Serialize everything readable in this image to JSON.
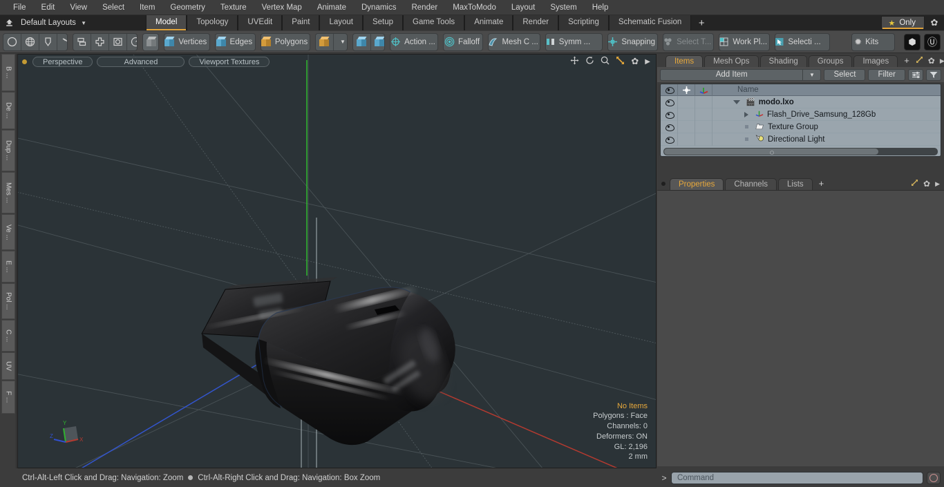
{
  "menubar": {
    "items": [
      "File",
      "Edit",
      "View",
      "Select",
      "Item",
      "Geometry",
      "Texture",
      "Vertex Map",
      "Animate",
      "Dynamics",
      "Render",
      "MaxToModo",
      "Layout",
      "System",
      "Help"
    ]
  },
  "layoutbar": {
    "home_icon": "home-icon",
    "layout_name": "Default Layouts",
    "tabs": [
      {
        "label": "Model",
        "active": true
      },
      {
        "label": "Topology",
        "active": false
      },
      {
        "label": "UVEdit",
        "active": false
      },
      {
        "label": "Paint",
        "active": false
      },
      {
        "label": "Layout",
        "active": false
      },
      {
        "label": "Setup",
        "active": false
      },
      {
        "label": "Game Tools",
        "active": false
      },
      {
        "label": "Animate",
        "active": false
      },
      {
        "label": "Render",
        "active": false
      },
      {
        "label": "Scripting",
        "active": false
      },
      {
        "label": "Schematic Fusion",
        "active": false
      }
    ],
    "add_tab_label": "+",
    "only_label": "Only",
    "only_icon": "star-icon",
    "gear_icon": "gear-icon"
  },
  "toolbar": {
    "groups": [
      {
        "items": [
          {
            "icon": "circle-icon",
            "label": ""
          },
          {
            "icon": "globe-icon",
            "label": ""
          },
          {
            "icon": "pen-icon",
            "label": ""
          },
          {
            "icon": "curve-icon",
            "label": ""
          }
        ]
      },
      {
        "items": [
          {
            "icon": "align-icon",
            "label": ""
          },
          {
            "icon": "center-icon",
            "label": ""
          },
          {
            "icon": "bound-icon",
            "label": ""
          },
          {
            "icon": "radial-icon",
            "label": ""
          }
        ]
      },
      {
        "items": [
          {
            "icon": "cube-grey-icon",
            "label": ""
          }
        ]
      },
      {
        "items": [
          {
            "icon": "cube-blue-icon",
            "label": "Vertices"
          }
        ]
      },
      {
        "items": [
          {
            "icon": "cube-blue-icon",
            "label": "Edges"
          }
        ]
      },
      {
        "items": [
          {
            "icon": "cube-orange-icon",
            "label": "Polygons"
          }
        ]
      },
      {
        "items": [
          {
            "icon": "cube-orange-icon",
            "label": ""
          },
          {
            "icon": "chevron-down-icon",
            "label": ""
          }
        ]
      },
      {
        "items": [
          {
            "icon": "cube-item-a-icon",
            "label": ""
          },
          {
            "icon": "cube-item-b-icon",
            "label": ""
          }
        ]
      },
      {
        "items": [
          {
            "icon": "action-center-icon",
            "label": "Action  ..."
          }
        ]
      },
      {
        "items": [
          {
            "icon": "falloff-icon",
            "label": "Falloff"
          }
        ]
      },
      {
        "items": [
          {
            "icon": "mesh-constraint-icon",
            "label": "Mesh C ..."
          }
        ]
      },
      {
        "items": [
          {
            "icon": "symmetry-icon",
            "label": "Symm ..."
          }
        ]
      },
      {
        "items": [
          {
            "icon": "snapping-icon",
            "label": "Snapping"
          }
        ]
      },
      {
        "items": [
          {
            "icon": "select-through-icon",
            "label": "Select T...",
            "dim": true
          }
        ]
      },
      {
        "items": [
          {
            "icon": "work-plane-icon",
            "label": "Work Pl..."
          }
        ]
      },
      {
        "items": [
          {
            "icon": "selection-icon",
            "label": "Selecti  ..."
          }
        ]
      },
      {
        "items": [
          {
            "icon": "kits-icon",
            "label": "Kits"
          }
        ]
      }
    ],
    "right_badges": [
      {
        "icon": "modo-badge-icon",
        "glyph": "⬢"
      },
      {
        "icon": "unreal-badge-icon",
        "glyph": "Ⓤ"
      }
    ]
  },
  "left_strip": {
    "tabs": [
      "B ...",
      "De ...",
      "Dup ...",
      "Mes ...",
      "Ve ...",
      "E ...",
      "Pol ...",
      "C ...",
      "UV",
      "F ..."
    ]
  },
  "viewport": {
    "dot_color": "#c39a34",
    "pills": [
      "Perspective",
      "Advanced",
      "Viewport Textures"
    ],
    "tool_icons": [
      "move-icon",
      "rotate-icon",
      "zoom-icon",
      "fit-icon",
      "gear-icon",
      "play-arrow-icon"
    ],
    "background_color": "#2b3337",
    "stats": {
      "selection": "No Items",
      "polygons": "Polygons : Face",
      "channels": "Channels: 0",
      "deformers": "Deformers: ON",
      "gl": "GL: 2,196",
      "scale": "2 mm"
    },
    "axis_gizmo": {
      "x": "X",
      "y": "Y",
      "z": "Z",
      "x_color": "#b03030",
      "y_color": "#2eb82e",
      "z_color": "#3050d0"
    }
  },
  "right_panel": {
    "top_tabs": [
      {
        "label": "Items",
        "active": true
      },
      {
        "label": "Mesh Ops",
        "active": false
      },
      {
        "label": "Shading",
        "active": false
      },
      {
        "label": "Groups",
        "active": false
      },
      {
        "label": "Images",
        "active": false
      }
    ],
    "top_tabs_plus": "+",
    "top_tab_icons": [
      "expand-icon",
      "gear-icon",
      "play-arrow-icon"
    ],
    "controls": {
      "add_item_label": "Add Item",
      "add_item_dropdown_icon": "chevron-down-icon",
      "select_label": "Select",
      "filter_label": "Filter",
      "list_options_icon": "list-options-icon",
      "funnel_icon": "funnel-icon"
    },
    "list_header": {
      "visibility_icon": "eye-icon",
      "lock_icon": "crosshair-icon",
      "axis_icon": "axis-icon",
      "name_label": "Name"
    },
    "items": [
      {
        "name": "modo.lxo",
        "icon": "scene-icon",
        "depth": 0,
        "expander": "down",
        "bold": true
      },
      {
        "name": "Flash_Drive_Samsung_128Gb",
        "icon": "mesh-icon",
        "depth": 1,
        "expander": "right",
        "bold": false
      },
      {
        "name": "Texture Group",
        "icon": "folder-icon",
        "depth": 1,
        "expander": "none",
        "bold": false
      },
      {
        "name": "Directional Light",
        "icon": "light-icon",
        "depth": 1,
        "expander": "none",
        "bold": false
      }
    ],
    "bottom_tabs": [
      {
        "label": "Properties",
        "active": true
      },
      {
        "label": "Channels",
        "active": false
      },
      {
        "label": "Lists",
        "active": false
      }
    ],
    "bottom_tabs_plus": "+",
    "bottom_tab_icons": [
      "expand-icon",
      "gear-icon",
      "play-arrow-icon"
    ]
  },
  "statusbar": {
    "left_hint": "Ctrl-Alt-Left Click and Drag: Navigation: Zoom",
    "right_hint": "Ctrl-Alt-Right Click and Drag: Navigation: Box Zoom",
    "command_prompt": ">",
    "command_placeholder": "Command",
    "command_value": "",
    "record_icon": "record-circle-icon"
  }
}
